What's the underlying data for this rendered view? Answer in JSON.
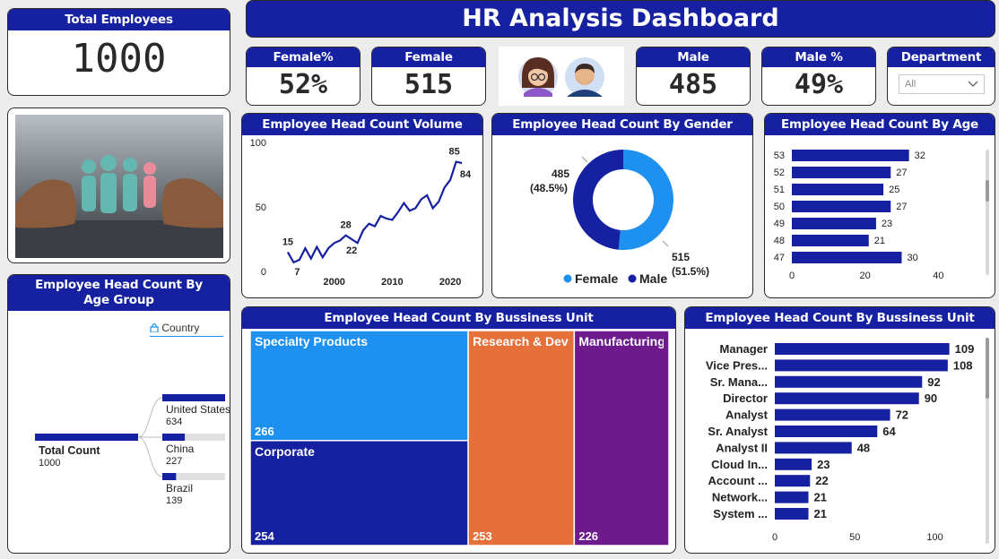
{
  "title": "HR Analysis Dashboard",
  "kpis": {
    "total": {
      "label": "Total Employees",
      "value": "1000"
    },
    "female_pct": {
      "label": "Female%",
      "value": "52%"
    },
    "female": {
      "label": "Female",
      "value": "515"
    },
    "male": {
      "label": "Male",
      "value": "485"
    },
    "male_pct": {
      "label": "Male %",
      "value": "49%"
    }
  },
  "department_filter": {
    "label": "Department",
    "selected": "All"
  },
  "colors": {
    "navy": "#1521a0",
    "light_blue": "#1e90f0",
    "orange": "#e5703a",
    "purple": "#6c1a8c",
    "bar": "#1521a0"
  },
  "trend": {
    "title": "Employee Head Count Volume Trend",
    "chart_data": {
      "type": "line",
      "x": [
        1992,
        1993,
        1994,
        1995,
        1996,
        1997,
        1998,
        1999,
        2000,
        2001,
        2002,
        2003,
        2004,
        2005,
        2006,
        2007,
        2008,
        2009,
        2010,
        2011,
        2012,
        2013,
        2014,
        2015,
        2016,
        2017,
        2018,
        2019,
        2020,
        2021,
        2022
      ],
      "y": [
        15,
        7,
        9,
        18,
        10,
        19,
        11,
        18,
        22,
        24,
        28,
        25,
        22,
        32,
        37,
        35,
        43,
        41,
        40,
        46,
        53,
        47,
        49,
        56,
        59,
        49,
        54,
        65,
        71,
        85,
        84
      ],
      "ylim": [
        0,
        100
      ],
      "yticks": [
        0,
        50,
        100
      ],
      "xticks": [
        2000,
        2010,
        2020
      ],
      "labels": [
        {
          "year": 1992,
          "text": "15"
        },
        {
          "year": 1993,
          "text": "7"
        },
        {
          "year": 2002,
          "text": "28"
        },
        {
          "year": 2003,
          "text": "22"
        },
        {
          "year": 2021,
          "text": "85"
        },
        {
          "year": 2022,
          "text": "84"
        }
      ]
    }
  },
  "gender": {
    "title": "Employee Head Count By Gender",
    "chart_data": {
      "type": "pie",
      "slices": [
        {
          "name": "Female",
          "value": 515,
          "label": "515",
          "pct": "(51.5%)",
          "color": "#1e90f0"
        },
        {
          "name": "Male",
          "value": 485,
          "label": "485",
          "pct": "(48.5%)",
          "color": "#1521a0"
        }
      ],
      "legend": [
        "Female",
        "Male"
      ]
    }
  },
  "age": {
    "title": "Employee Head Count By Age Group",
    "chart_data": {
      "type": "bar",
      "categories": [
        "53",
        "52",
        "51",
        "50",
        "49",
        "48",
        "47"
      ],
      "values": [
        32,
        27,
        25,
        27,
        23,
        21,
        30
      ],
      "xticks": [
        0,
        20,
        40
      ],
      "xlim": [
        0,
        48
      ]
    }
  },
  "tree": {
    "title": "Employee Head Count By Age Group",
    "filter_label": "Country",
    "root": {
      "label": "Total Count",
      "value": "1000"
    },
    "children": [
      {
        "label": "United States",
        "value": "634",
        "count": 634
      },
      {
        "label": "China",
        "value": "227",
        "count": 227
      },
      {
        "label": "Brazil",
        "value": "139",
        "count": 139
      }
    ]
  },
  "treemap": {
    "title": "Employee Head Count By Bussiness Unit",
    "chart_data": {
      "type": "treemap",
      "items": [
        {
          "name": "Specialty Products",
          "value": 266,
          "color": "#1e90f0"
        },
        {
          "name": "Corporate",
          "value": 254,
          "color": "#1521a0"
        },
        {
          "name": "Research & Development",
          "value": 253,
          "color": "#e5703a"
        },
        {
          "name": "Manufacturing",
          "value": 226,
          "color": "#6c1a8c"
        }
      ]
    }
  },
  "jobs": {
    "title": "Employee Head Count By Bussiness Unit",
    "chart_data": {
      "type": "bar",
      "categories": [
        "Manager",
        "Vice Pres...",
        "Sr. Mana...",
        "Director",
        "Analyst",
        "Sr. Analyst",
        "Analyst II",
        "Cloud In...",
        "Account ...",
        "Network...",
        "System ..."
      ],
      "values": [
        109,
        108,
        92,
        90,
        72,
        64,
        48,
        23,
        22,
        21,
        21
      ],
      "xticks": [
        0,
        50,
        100
      ],
      "xlim": [
        0,
        112
      ]
    }
  }
}
